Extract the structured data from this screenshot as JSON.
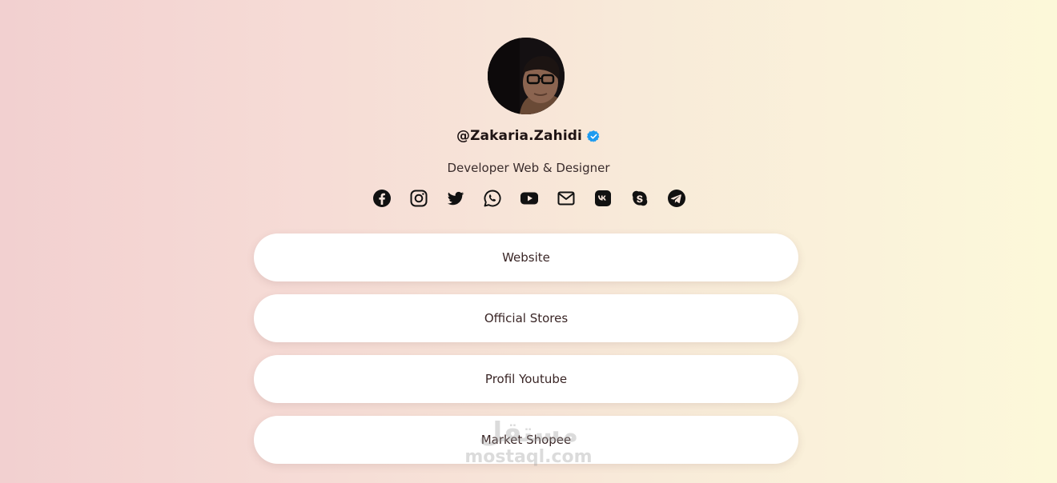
{
  "profile": {
    "username": "@Zakaria.Zahidi",
    "bio": "Developer Web & Designer",
    "verified_color": "#1d9bf0"
  },
  "socials": [
    {
      "name": "facebook-icon"
    },
    {
      "name": "instagram-icon"
    },
    {
      "name": "twitter-icon"
    },
    {
      "name": "whatsapp-icon"
    },
    {
      "name": "youtube-icon"
    },
    {
      "name": "email-icon"
    },
    {
      "name": "vk-icon"
    },
    {
      "name": "skype-icon"
    },
    {
      "name": "telegram-icon"
    }
  ],
  "links": [
    {
      "label": "Website"
    },
    {
      "label": "Official Stores"
    },
    {
      "label": "Profil Youtube"
    },
    {
      "label": "Market Shopee"
    }
  ],
  "watermark": {
    "arabic": "مستقل",
    "latin": "mostaql.com"
  },
  "colors": {
    "background_left": "#f2d0d0",
    "background_right": "#fcf8d9",
    "button_bg": "#ffffff",
    "icon": "#111111"
  }
}
